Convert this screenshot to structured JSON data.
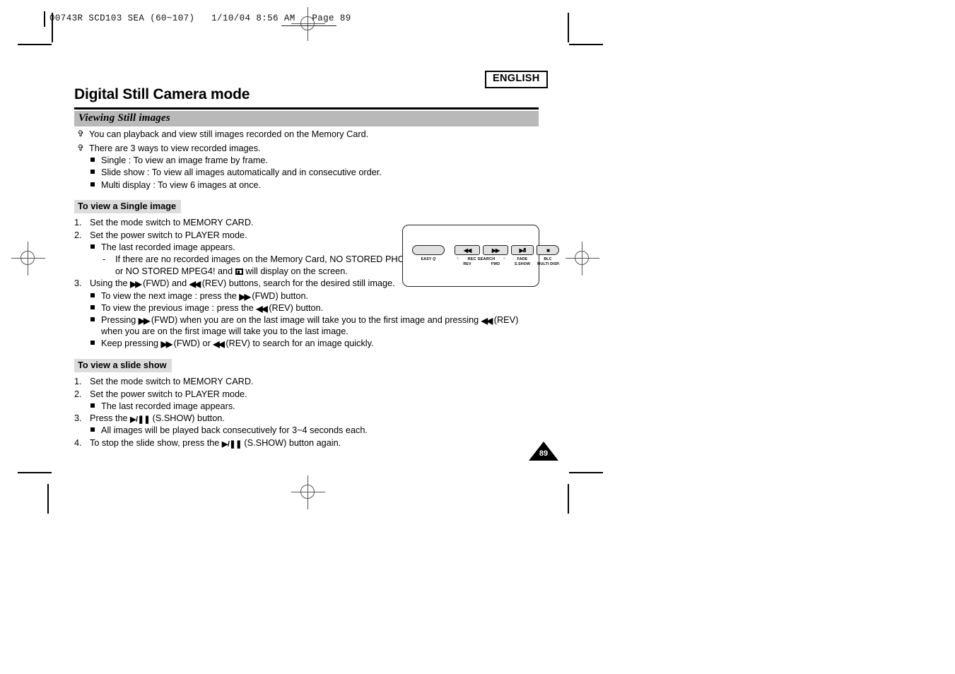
{
  "print_header": {
    "text": "00743R SCD103 SEA (60~107)   1/10/04 8:56 AM   Page 89"
  },
  "language_badge": "ENGLISH",
  "page_title": "Digital Still Camera mode",
  "section": {
    "heading": "Viewing Still images",
    "intro": [
      "You can playback and view still images recorded on the Memory Card.",
      "There are 3 ways to view recorded images."
    ],
    "ways": [
      "Single : To view an image frame by frame.",
      "Slide show : To view all images automatically and in consecutive order.",
      "Multi display : To view 6 images at once."
    ]
  },
  "single_image": {
    "heading": "To view a Single image",
    "step1_num": "1.",
    "step1": "Set the mode switch to MEMORY CARD.",
    "step2_num": "2.",
    "step2": "Set the power switch to PLAYER mode.",
    "step2_sub": "The last recorded image appears.",
    "step2_dash_mark": "-",
    "step2_dash_a": "If there are no recorded images on the Memory Card, NO STORED PHOTO!",
    "step2_dash_b_pre": "or NO STORED MPEG4! and",
    "step2_dash_b_post": "will display on the screen.",
    "step3_num": "3.",
    "step3_pre": "Using the",
    "step3_mid": "(FWD) and",
    "step3_mid2": "(REV) buttons, search for the desired still image.",
    "b1_pre": "To view the next image : press the",
    "b1_post": "(FWD) button.",
    "b2_pre": "To view the previous image : press the",
    "b2_post": "(REV) button.",
    "b3_pre": "Pressing",
    "b3_mid": "(FWD) when you are on the last image will take you to the first",
    "b3_line2_pre": "image and pressing",
    "b3_line2_post": "(REV) when you are on the first image will take you",
    "b3_line3": "to the last image.",
    "b4_pre": "Keep pressing",
    "b4_mid": "(FWD) or",
    "b4_post": "(REV) to search for an image quickly."
  },
  "slide_show": {
    "heading": "To view a slide show",
    "step1_num": "1.",
    "step1": "Set the mode switch to MEMORY CARD.",
    "step2_num": "2.",
    "step2": "Set the power switch to PLAYER mode.",
    "step2_sub": "The last recorded image appears.",
    "step3_num": "3.",
    "step3_pre": "Press the",
    "step3_post": "(S.SHOW) button.",
    "step3_sub": "All images will be played back consecutively for 3~4 seconds each.",
    "step4_num": "4.",
    "step4_pre": "To stop the slide show, press the",
    "step4_post": "(S.SHOW) button again."
  },
  "figure": {
    "name": "camera-button-panel",
    "buttons": [
      {
        "glyph": "",
        "label_top": "",
        "label_bottom": ""
      },
      {
        "glyph": "◂◂",
        "label_top": "",
        "label_bottom": "REV"
      },
      {
        "glyph": "▸▸",
        "label_top": "",
        "label_bottom": "FWD"
      },
      {
        "glyph": "▸/❚❚",
        "label_top": "FADE",
        "label_bottom": "S.SHOW"
      },
      {
        "glyph": "■",
        "label_top": "BLC",
        "label_bottom": "MULTI DISP."
      }
    ],
    "easy_label": "EASY",
    "rec_search_label": "REC SEARCH"
  },
  "page_number": "89",
  "colors": {
    "band_gray": "#b9b9b9",
    "subhead_gray": "#dcdcdc",
    "button_gray": "#e0e0e0",
    "ink": "#000000"
  }
}
